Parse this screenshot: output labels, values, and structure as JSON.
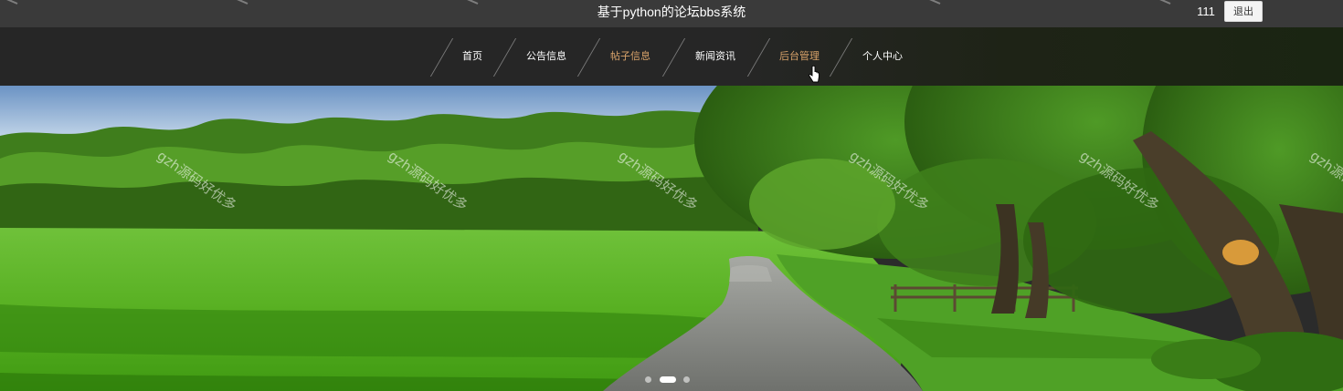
{
  "header": {
    "title": "基于python的论坛bbs系统",
    "username": "111",
    "logout_label": "退出"
  },
  "nav": {
    "items": [
      {
        "label": "首页"
      },
      {
        "label": "公告信息"
      },
      {
        "label": "帖子信息"
      },
      {
        "label": "新闻资讯"
      },
      {
        "label": "后台管理"
      },
      {
        "label": "个人中心"
      }
    ],
    "active_color": "#d9a36a",
    "text_color": "#ffffff"
  },
  "banner": {
    "slides_count": 3,
    "active_slide": 2
  },
  "watermark": {
    "text": "gzh源码好优多"
  },
  "colors": {
    "topbar": "#3a3a3a",
    "navbar": "#262626",
    "logout_bg": "#f4f4f4"
  }
}
